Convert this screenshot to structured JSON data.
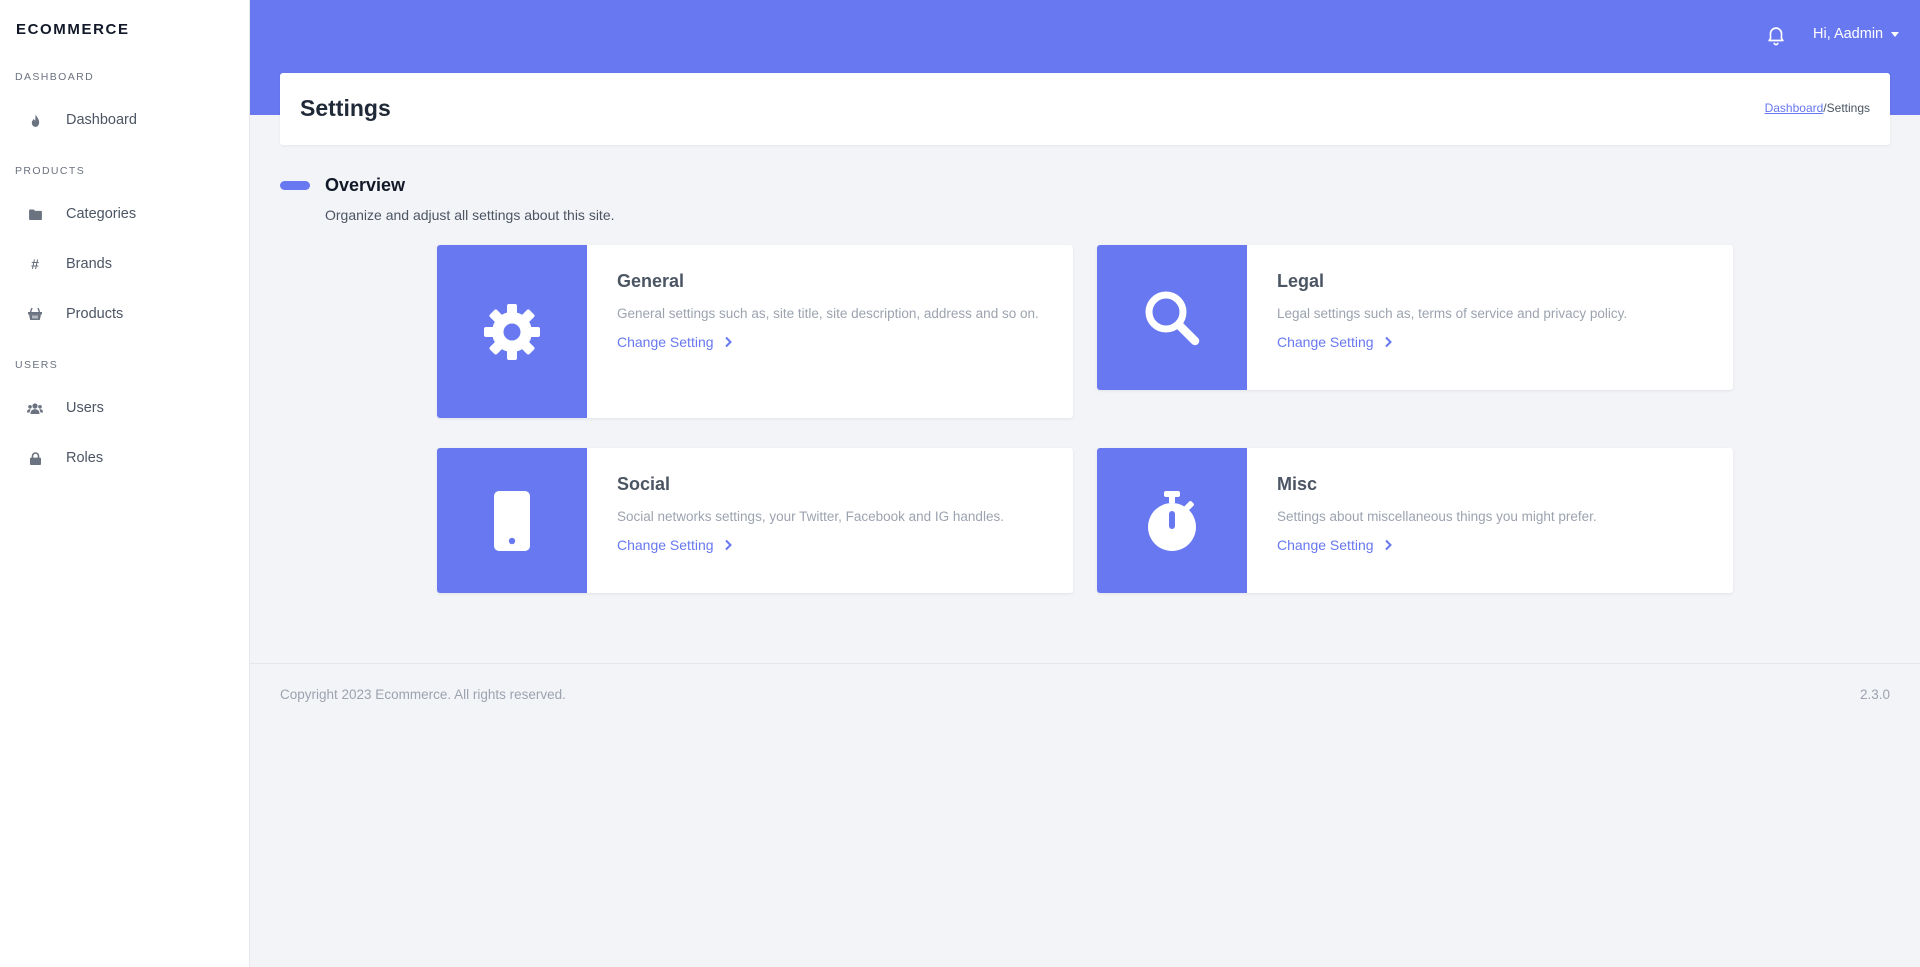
{
  "sidebar": {
    "brand": "ECOMMERCE",
    "sections": [
      {
        "label": "DASHBOARD"
      },
      {
        "label": "PRODUCTS"
      },
      {
        "label": "USERS"
      }
    ],
    "items": [
      {
        "label": "Dashboard",
        "icon": "fire-icon"
      },
      {
        "label": "Categories",
        "icon": "folder-icon"
      },
      {
        "label": "Brands",
        "icon": "hashtag-icon"
      },
      {
        "label": "Products",
        "icon": "basket-icon"
      },
      {
        "label": "Users",
        "icon": "users-icon"
      },
      {
        "label": "Roles",
        "icon": "lock-icon"
      }
    ]
  },
  "header": {
    "notification_icon": "bell-icon",
    "user_greeting": "Hi, Aadmin"
  },
  "page": {
    "title": "Settings",
    "breadcrumb": {
      "link": "Dashboard",
      "current": "Settings",
      "separator": "/"
    }
  },
  "overview": {
    "title": "Overview",
    "description": "Organize and adjust all settings about this site."
  },
  "cards": [
    {
      "title": "General",
      "description": "General settings such as, site title, site description, address and so on.",
      "link": "Change Setting",
      "icon": "gear-icon"
    },
    {
      "title": "Legal",
      "description": "Legal settings such as, terms of service and privacy policy.",
      "link": "Change Setting",
      "icon": "search-icon"
    },
    {
      "title": "Social",
      "description": "Social networks settings, your Twitter, Facebook and IG handles.",
      "link": "Change Setting",
      "icon": "mobile-icon"
    },
    {
      "title": "Misc",
      "description": "Settings about miscellaneous things you might prefer.",
      "link": "Change Setting",
      "icon": "stopwatch-icon"
    }
  ],
  "footer": {
    "copyright": "Copyright 2023 Ecommerce. All rights reserved.",
    "version": "2.3.0"
  },
  "colors": {
    "accent": "#6878f0",
    "background": "#f3f4f7"
  }
}
